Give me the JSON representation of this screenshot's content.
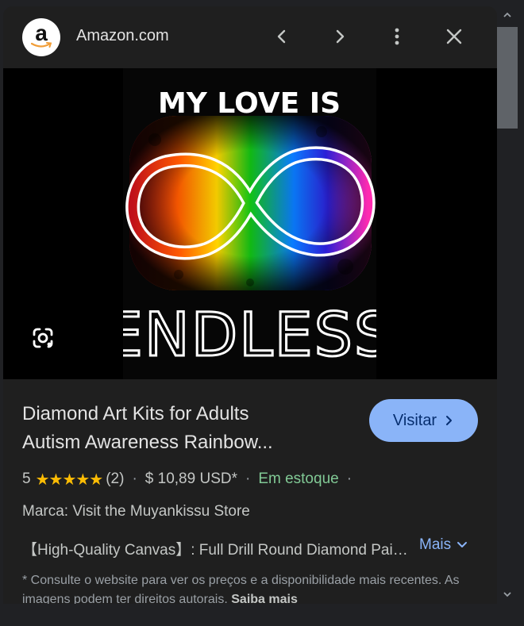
{
  "header": {
    "logo_letter": "a",
    "site_name": "Amazon.com",
    "icons": {
      "back": "chevron-left-icon",
      "forward": "chevron-right-icon",
      "more": "more-vertical-icon",
      "close": "close-icon"
    }
  },
  "image": {
    "text_top": "MY LOVE IS",
    "text_bottom": "ENDLESS",
    "lens_icon": "google-lens-icon"
  },
  "product": {
    "title_line1": "Diamond Art Kits for Adults",
    "title_line2": "Autism Awareness Rainbow...",
    "visit_label": "Visitar",
    "rating_value": "5",
    "stars": "★★★★★",
    "review_count": "(2)",
    "price": "$ 10,89 USD*",
    "stock": "Em estoque",
    "brand": "Marca: Visit the Muyankissu Store",
    "description": "【High-Quality Canvas】: Full Drill Round Diamond Painting Kit",
    "more_label": "Mais",
    "disclaimer": "* Consulte o website para ver os preços e a disponibilidade mais recentes. As imagens podem ter direitos autorais.",
    "learn_more": "Saiba mais"
  },
  "colors": {
    "accent": "#8ab4f8",
    "stock_green": "#81c995",
    "star_yellow": "#fbbc04",
    "background": "#1f1f1f"
  }
}
